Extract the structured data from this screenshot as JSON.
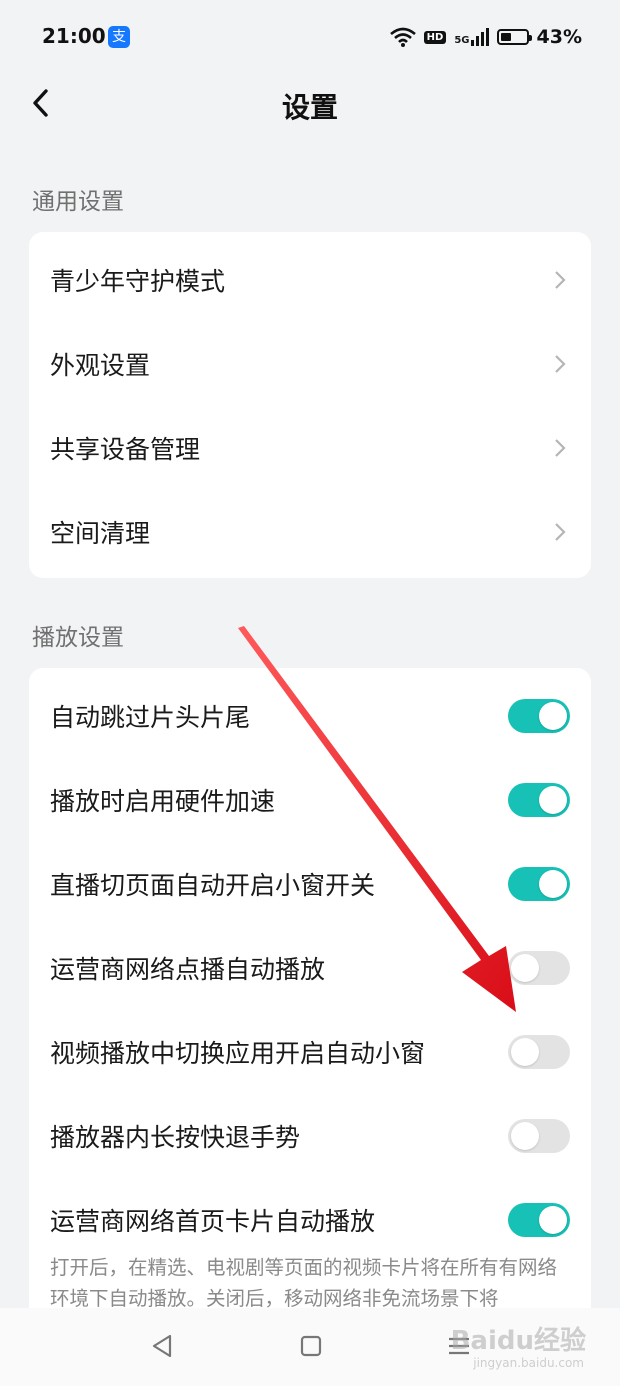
{
  "status_bar": {
    "time": "21:00",
    "app_badge": "支",
    "icons": [
      "wifi-icon",
      "hd-icon",
      "5g-signal-icon",
      "battery-icon"
    ],
    "hd": "HD",
    "network": "5G",
    "battery_percent": "43%",
    "battery_level": 0.43
  },
  "header": {
    "title": "设置"
  },
  "sections": [
    {
      "heading": "通用设置",
      "items": [
        {
          "label": "青少年守护模式",
          "control": "chevron"
        },
        {
          "label": "外观设置",
          "control": "chevron"
        },
        {
          "label": "共享设备管理",
          "control": "chevron"
        },
        {
          "label": "空间清理",
          "control": "chevron"
        }
      ]
    },
    {
      "heading": "播放设置",
      "items": [
        {
          "label": "自动跳过片头片尾",
          "control": "toggle",
          "on": true
        },
        {
          "label": "播放时启用硬件加速",
          "control": "toggle",
          "on": true
        },
        {
          "label": "直播切页面自动开启小窗开关",
          "control": "toggle",
          "on": true
        },
        {
          "label": "运营商网络点播自动播放",
          "control": "toggle",
          "on": false
        },
        {
          "label": "视频播放中切换应用开启自动小窗",
          "control": "toggle",
          "on": false
        },
        {
          "label": "播放器内长按快退手势",
          "control": "toggle",
          "on": false
        },
        {
          "label": "运营商网络首页卡片自动播放",
          "control": "toggle",
          "on": true
        }
      ],
      "description": "打开后，在精选、电视剧等页面的视频卡片将在所有有网络环境下自动播放。关闭后，移动网络非免流场景下将"
    }
  ],
  "bottom_nav": [
    "back-triangle-icon",
    "home-square-icon",
    "menu-lines-icon"
  ],
  "watermark": {
    "text": "Baidu经验",
    "sub": "jingyan.baidu.com"
  },
  "colors": {
    "toggle_on": "#17c1b5",
    "toggle_off": "#e3e3e3",
    "annotation_arrow": "#e0141e"
  }
}
